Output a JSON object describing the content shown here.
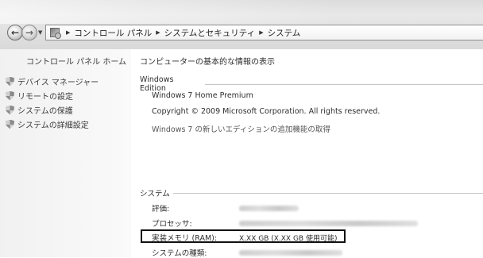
{
  "address_bar": {
    "breadcrumbs": [
      "コントロール パネル",
      "システムとセキュリティ",
      "システム"
    ]
  },
  "sidebar": {
    "home_link": "コントロール パネル ホーム",
    "tasks": [
      {
        "label": "デバイス マネージャー",
        "icon": "shield-icon"
      },
      {
        "label": "リモートの設定",
        "icon": "shield-icon"
      },
      {
        "label": "システムの保護",
        "icon": "shield-icon"
      },
      {
        "label": "システムの詳細設定",
        "icon": "shield-icon"
      }
    ]
  },
  "main": {
    "heading": "コンピューターの基本的な情報の表示",
    "windows_edition": {
      "title": "Windows Edition",
      "edition": "Windows 7 Home Premium",
      "copyright": "Copyright © 2009 Microsoft Corporation.  All rights reserved.",
      "upgrade_link": "Windows 7 の新しいエディションの追加機能の取得"
    },
    "system": {
      "title": "システム",
      "rows": [
        {
          "label": "評価:",
          "value": "",
          "blurred": true
        },
        {
          "label": "プロセッサ:",
          "value": "",
          "blurred": true
        },
        {
          "label": "実装メモリ (RAM):",
          "value": "X.XX GB (X.XX GB 使用可能)",
          "blurred": false
        },
        {
          "label": "システムの種類:",
          "value": "",
          "blurred": true
        }
      ]
    }
  },
  "colors": {
    "highlight_border": "#111111",
    "sidebar_bg": "#f1f1f1",
    "section_rule": "#c6c6c6"
  }
}
